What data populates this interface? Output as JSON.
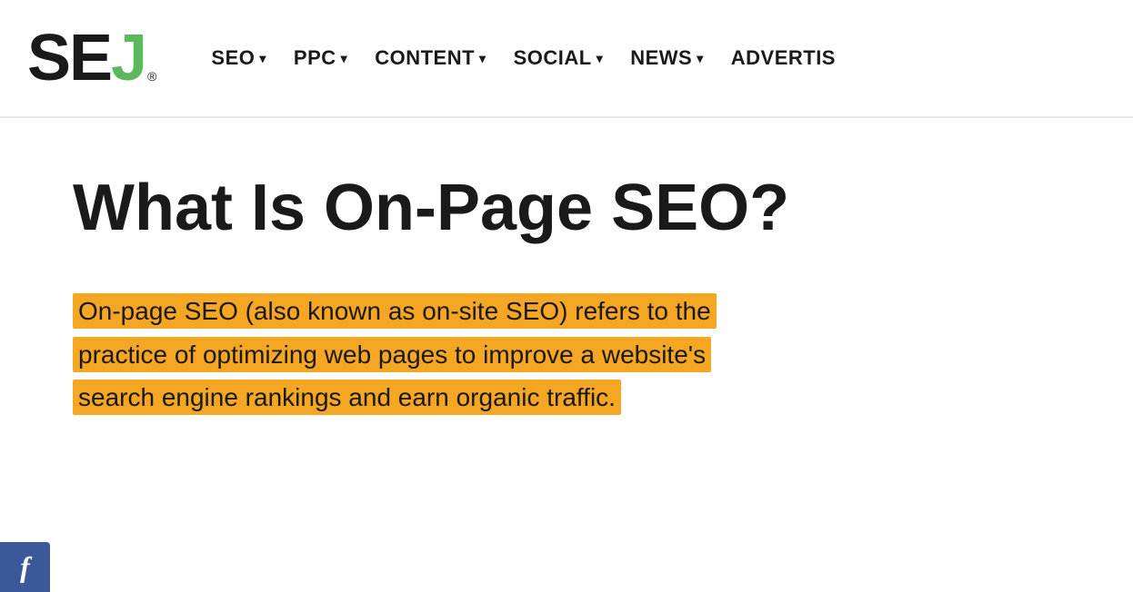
{
  "header": {
    "logo": {
      "se": "SE",
      "j": "J",
      "registered": "®"
    },
    "nav": {
      "items": [
        {
          "label": "SEO",
          "id": "seo"
        },
        {
          "label": "PPC",
          "id": "ppc"
        },
        {
          "label": "CONTENT",
          "id": "content"
        },
        {
          "label": "SOCIAL",
          "id": "social"
        },
        {
          "label": "NEWS",
          "id": "news"
        },
        {
          "label": "ADVERTIS",
          "id": "advertis"
        }
      ],
      "chevron": "▾"
    }
  },
  "main": {
    "page_title": "What Is On-Page SEO?",
    "description_part1": "On-page SEO (also known as on-site SEO) refers to the",
    "description_part2": "practice of optimizing web pages to improve a website's",
    "description_part3": "search engine rankings and earn organic traffic.",
    "highlight_color": "#f5a623"
  },
  "social": {
    "facebook_label": "f"
  },
  "colors": {
    "logo_j": "#5cb85c",
    "nav_text": "#1a1a1a",
    "title_text": "#1a1a1a",
    "highlight": "#f5a623",
    "facebook_bg": "#3b5998"
  }
}
